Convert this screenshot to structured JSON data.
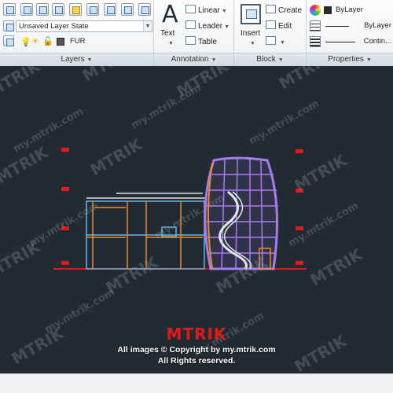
{
  "ribbon": {
    "layers": {
      "layer_state": "Unsaved Layer State",
      "current_layer": "FUR",
      "title": "Layers"
    },
    "annotation": {
      "text_label": "Text",
      "linear_label": "Linear",
      "leader_label": "Leader",
      "table_label": "Table",
      "title": "Annotation"
    },
    "block": {
      "insert_label": "Insert",
      "create_label": "Create",
      "edit_label": "Edit",
      "title": "Block"
    },
    "properties": {
      "color": "ByLayer",
      "linetype": "ByLayer",
      "lineweight": "Contin...",
      "title": "Properties"
    }
  },
  "watermark": {
    "brand": "MTRIK",
    "site": "my.mtrik.com"
  },
  "credit": {
    "logo": "MTRIK",
    "copyright": "All images © Copyright by my.mtrik.com",
    "rights": "All Rights reserved."
  },
  "colors": {
    "canvas_bg": "#222b33",
    "accent_red": "#e01919",
    "dome_purple": "#a77cf0",
    "frame_orange": "#f08a1c",
    "frame_cyan": "#5fb8e8"
  }
}
